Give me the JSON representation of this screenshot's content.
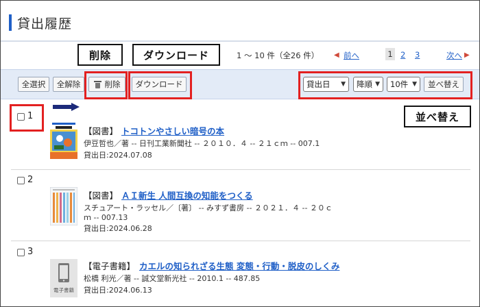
{
  "page": {
    "title": "貸出履歴"
  },
  "callouts": {
    "delete": "削除",
    "download": "ダウンロード",
    "sort": "並べ替え"
  },
  "pagination": {
    "range": "1 ～ 10 件（全26 件）",
    "prev_arrow": "◀",
    "prev": "前へ",
    "pages": [
      "1",
      "2",
      "3"
    ],
    "current_page": "1",
    "next": "次へ",
    "next_arrow": "▶"
  },
  "toolbar": {
    "select_all": "全選択",
    "deselect_all": "全解除",
    "delete": "削除",
    "download": "ダウンロード",
    "sort_field": "貸出日",
    "sort_order": "降順",
    "page_size": "10件",
    "sort_button": "並べ替え"
  },
  "items": [
    {
      "num": "1",
      "material_type": "【図書】",
      "title": "トコトンやさしい暗号の本",
      "meta": "伊豆哲也／著 -- 日刊工業新聞社 -- ２０１０．４ -- ２１ｃｍ -- 007.1",
      "loan_date": "貸出日:2024.07.08"
    },
    {
      "num": "2",
      "material_type": "【図書】",
      "title": "ＡＩ新生 人間互換の知能をつくる",
      "meta_line1": "スチュアート・ラッセル／〔著〕 -- みすず書房 -- ２０２１．４ -- ２０ｃ",
      "meta_line2": "ｍ -- 007.13",
      "loan_date": "貸出日:2024.06.28"
    },
    {
      "num": "3",
      "material_type": "【電子書籍】",
      "title": "カエルの知られざる生態 変態・行動・脱皮のしくみ",
      "meta": "松橋 利光／著 -- 誠文堂新光社 -- 2010.1 -- 487.85",
      "loan_date": "貸出日:2024.06.13",
      "thumb_label": "電子書籍"
    }
  ],
  "colors": {
    "accent": "#1f5fc7",
    "link": "#1f5fc7",
    "highlight_box": "#e32020",
    "toolbar_bg": "#e3ebf7",
    "arrow": "#1c2a7a"
  }
}
